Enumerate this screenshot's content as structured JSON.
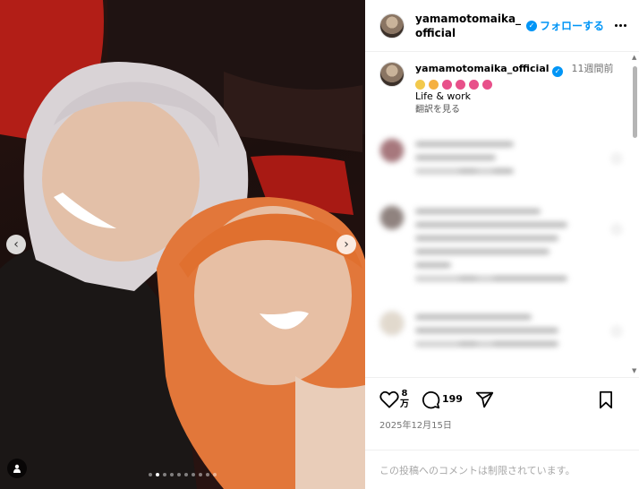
{
  "media": {
    "prev_glyph": "‹",
    "next_glyph": "›",
    "carousel_slides": 10,
    "carousel_active_index": 1
  },
  "header": {
    "username": "yamamotomaika_official",
    "follow_label": "フォローする",
    "verified_glyph": "✓"
  },
  "caption": {
    "username": "yamamotomaika_official",
    "age": "11週間前",
    "text": "Life & work",
    "translate": "翻訳を見る"
  },
  "actions": {
    "likes_number": "8",
    "likes_unit": "万",
    "comments_count": "199",
    "date": "2025年12月15日"
  },
  "footer": {
    "comments_restricted": "この投稿へのコメントは制限されています。"
  },
  "colors": {
    "accent": "#0095f6",
    "muted": "#737373",
    "emoji_pink": "#e8508a"
  },
  "icons": {
    "like": "heart-icon",
    "comment": "comment-icon",
    "share": "send-icon",
    "save": "bookmark-icon",
    "more": "more-icon",
    "tag": "user-tag-icon"
  }
}
